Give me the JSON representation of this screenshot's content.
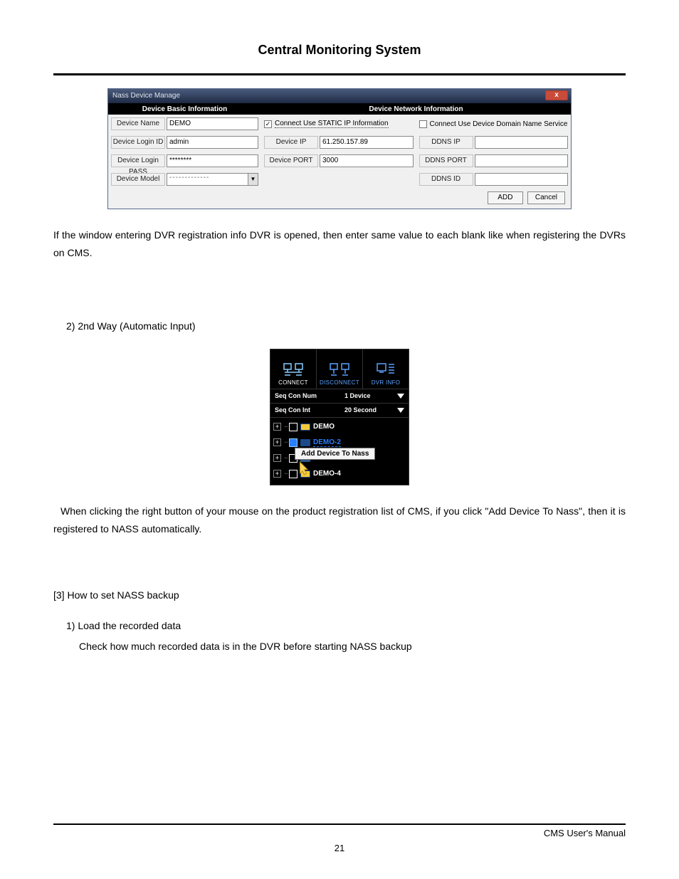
{
  "doc": {
    "title": "Central Monitoring System",
    "footer": "CMS User's Manual",
    "page": "21"
  },
  "dlg1": {
    "title": "Nass Device Manage",
    "left_header": "Device Basic Information",
    "right_header": "Device Network Information",
    "labels": {
      "name": "Device Name",
      "login_id": "Device Login ID",
      "login_pass": "Device Login PASS",
      "model": "Device Model",
      "ip": "Device IP",
      "port": "Device PORT",
      "ddns_ip": "DDNS IP",
      "ddns_port": "DDNS PORT",
      "ddns_id": "DDNS ID"
    },
    "values": {
      "name": "DEMO",
      "login_id": "admin",
      "login_pass": "********",
      "model": "-------------",
      "ip": "61.250.157.89",
      "port": "3000",
      "ddns_ip": "",
      "ddns_port": "",
      "ddns_id": ""
    },
    "chk_static": {
      "label": "Connect Use STATIC IP Information",
      "checked": true
    },
    "chk_ddns": {
      "label": "Connect Use Device Domain Name Service",
      "checked": false
    },
    "btn_add": "ADD",
    "btn_cancel": "Cancel"
  },
  "para1": "If the window entering DVR registration info DVR is opened, then enter same value to each blank like when registering the DVRs on CMS.",
  "heading2": "2) 2nd Way (Automatic Input)",
  "cms": {
    "tabs": {
      "connect": "CONNECT",
      "disconnect": "DISCONNECT",
      "dvrinfo": "DVR INFO"
    },
    "rows": {
      "seq_num_label": "Seq Con Num",
      "seq_num_value": "1 Device",
      "seq_int_label": "Seq Con Int",
      "seq_int_value": "20 Second"
    },
    "items": [
      "DEMO",
      "DEMO-2",
      "",
      "DEMO-4"
    ],
    "context_menu": "Add Device To Nass"
  },
  "para2": "When clicking the right button of your mouse on the product registration list of CMS, if you click \"Add Device To Nass\", then it is registered to NASS automatically.",
  "heading3": "[3] How to set NASS backup",
  "heading3_1": "1) Load the recorded data",
  "para3": "Check how much recorded data is in the DVR before starting NASS backup"
}
